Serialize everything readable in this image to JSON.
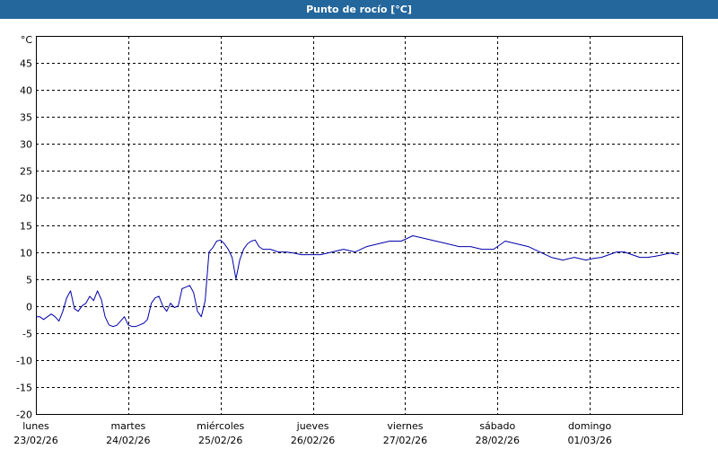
{
  "window": {
    "title": "Punto de rocío [°C]"
  },
  "colors": {
    "header_bg": "#24679c",
    "series_line": "#0000aa",
    "grid": "#000000"
  },
  "chart_data": {
    "type": "line",
    "title": "Punto de rocío [°C]",
    "ylabel": "°C",
    "ylim": [
      -20,
      50
    ],
    "yticks": [
      -20,
      -15,
      -10,
      -5,
      0,
      5,
      10,
      15,
      20,
      25,
      30,
      35,
      40,
      45
    ],
    "grid": true,
    "x_range": [
      "2026-02-23T00:00",
      "2026-03-02T00:00"
    ],
    "x_ticks": [
      {
        "day": "lunes",
        "date": "23/02/26"
      },
      {
        "day": "martes",
        "date": "24/02/26"
      },
      {
        "day": "miércoles",
        "date": "25/02/26"
      },
      {
        "day": "jueves",
        "date": "26/02/26"
      },
      {
        "day": "viernes",
        "date": "27/02/26"
      },
      {
        "day": "sábado",
        "date": "28/02/26"
      },
      {
        "day": "domingo",
        "date": "01/03/26"
      }
    ],
    "series": [
      {
        "x": [
          "2026-02-23T00:00",
          "2026-02-23T01:00",
          "2026-02-23T02:00",
          "2026-02-23T03:00",
          "2026-02-23T04:00",
          "2026-02-23T05:00",
          "2026-02-23T06:00",
          "2026-02-23T07:00",
          "2026-02-23T08:00",
          "2026-02-23T09:00",
          "2026-02-23T10:00",
          "2026-02-23T11:00",
          "2026-02-23T12:00",
          "2026-02-23T13:00",
          "2026-02-23T14:00",
          "2026-02-23T15:00",
          "2026-02-23T16:00",
          "2026-02-23T17:00",
          "2026-02-23T18:00",
          "2026-02-23T19:00",
          "2026-02-23T20:00",
          "2026-02-23T21:00",
          "2026-02-23T22:00",
          "2026-02-23T23:00",
          "2026-02-24T00:00",
          "2026-02-24T01:00",
          "2026-02-24T02:00",
          "2026-02-24T03:00",
          "2026-02-24T04:00",
          "2026-02-24T05:00",
          "2026-02-24T06:00",
          "2026-02-24T07:00",
          "2026-02-24T08:00",
          "2026-02-24T09:00",
          "2026-02-24T10:00",
          "2026-02-24T11:00",
          "2026-02-24T12:00",
          "2026-02-24T13:00",
          "2026-02-24T14:00",
          "2026-02-24T15:00",
          "2026-02-24T16:00",
          "2026-02-24T17:00",
          "2026-02-24T18:00",
          "2026-02-24T19:00",
          "2026-02-24T20:00",
          "2026-02-24T21:00",
          "2026-02-24T22:00",
          "2026-02-24T23:00",
          "2026-02-25T00:00",
          "2026-02-25T01:00",
          "2026-02-25T02:00",
          "2026-02-25T03:00",
          "2026-02-25T04:00",
          "2026-02-25T05:00",
          "2026-02-25T06:00",
          "2026-02-25T07:00",
          "2026-02-25T08:00",
          "2026-02-25T09:00",
          "2026-02-25T10:00",
          "2026-02-25T11:00",
          "2026-02-25T12:00",
          "2026-02-25T13:00",
          "2026-02-25T15:00",
          "2026-02-25T17:00",
          "2026-02-25T19:00",
          "2026-02-25T21:00",
          "2026-02-25T23:00",
          "2026-02-26T02:00",
          "2026-02-26T05:00",
          "2026-02-26T08:00",
          "2026-02-26T11:00",
          "2026-02-26T14:00",
          "2026-02-26T17:00",
          "2026-02-26T20:00",
          "2026-02-26T23:00",
          "2026-02-27T02:00",
          "2026-02-27T05:00",
          "2026-02-27T08:00",
          "2026-02-27T11:00",
          "2026-02-27T14:00",
          "2026-02-27T17:00",
          "2026-02-27T20:00",
          "2026-02-27T23:00",
          "2026-02-28T02:00",
          "2026-02-28T05:00",
          "2026-02-28T08:00",
          "2026-02-28T11:00",
          "2026-02-28T14:00",
          "2026-02-28T17:00",
          "2026-02-28T20:00",
          "2026-02-28T23:00",
          "2026-03-01T01:00",
          "2026-03-01T03:00",
          "2026-03-01T05:00",
          "2026-03-01T07:00",
          "2026-03-01T09:00",
          "2026-03-01T11:00",
          "2026-03-01T13:00",
          "2026-03-01T15:00",
          "2026-03-01T17:00",
          "2026-03-01T19:00",
          "2026-03-01T21:00",
          "2026-03-01T23:00"
        ],
        "y": [
          -2.0,
          -2.0,
          -2.5,
          -2.0,
          -1.5,
          -2.0,
          -2.8,
          -1.0,
          1.5,
          2.8,
          -0.5,
          -1.0,
          0.0,
          0.5,
          1.8,
          1.0,
          2.8,
          1.2,
          -2.0,
          -3.5,
          -3.8,
          -3.6,
          -2.8,
          -2.0,
          -3.5,
          -3.8,
          -3.8,
          -3.5,
          -3.2,
          -2.5,
          0.5,
          1.5,
          1.8,
          0.0,
          -1.0,
          0.5,
          -0.3,
          0.0,
          3.2,
          3.5,
          3.8,
          2.5,
          -1.0,
          -2.0,
          1.0,
          10.0,
          10.8,
          12.0,
          12.2,
          11.5,
          10.5,
          9.0,
          5.0,
          8.5,
          10.5,
          11.5,
          12.0,
          12.2,
          11.0,
          10.5,
          10.5,
          10.5,
          10.0,
          10.0,
          9.8,
          9.5,
          9.5,
          9.5,
          10.0,
          10.5,
          10.0,
          11.0,
          11.5,
          12.0,
          12.0,
          13.0,
          12.5,
          12.0,
          11.5,
          11.0,
          11.0,
          10.5,
          10.5,
          12.0,
          11.5,
          11.0,
          10.0,
          9.0,
          8.5,
          9.0,
          8.5,
          8.8,
          9.0,
          9.5,
          10.0,
          10.0,
          9.5,
          9.0,
          9.0,
          9.2,
          9.5,
          9.8,
          9.5
        ]
      }
    ]
  }
}
